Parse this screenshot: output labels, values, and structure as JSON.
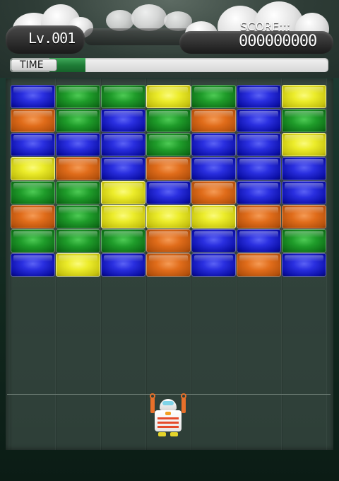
{
  "hud": {
    "level_text": "Lv.001",
    "score_label": "SCORE:::",
    "score_value": "000000000",
    "time_label": "TIME",
    "time_remaining_fraction": 0.13
  },
  "colors": {
    "blue": "#2a2fe0",
    "green": "#1f9c2a",
    "yellow": "#ecec2a",
    "orange": "#e06c1a",
    "time_fill": "#1f7d37"
  },
  "grid": {
    "columns": 7,
    "rows": 8,
    "blocks": [
      [
        "blue",
        "green",
        "green",
        "yellow",
        "green",
        "blue",
        "yellow"
      ],
      [
        "orange",
        "green",
        "blue",
        "green",
        "orange",
        "blue",
        "green"
      ],
      [
        "blue",
        "blue",
        "blue",
        "green",
        "blue",
        "blue",
        "yellow"
      ],
      [
        "yellow",
        "orange",
        "blue",
        "orange",
        "blue",
        "blue",
        "blue"
      ],
      [
        "green",
        "green",
        "yellow",
        "blue",
        "orange",
        "blue",
        "blue"
      ],
      [
        "orange",
        "green",
        "yellow",
        "yellow",
        "yellow",
        "orange",
        "orange"
      ],
      [
        "green",
        "green",
        "green",
        "orange",
        "blue",
        "blue",
        "green"
      ],
      [
        "blue",
        "yellow",
        "blue",
        "orange",
        "blue",
        "orange",
        "blue"
      ]
    ]
  },
  "player": {
    "icon": "robot-icon"
  }
}
